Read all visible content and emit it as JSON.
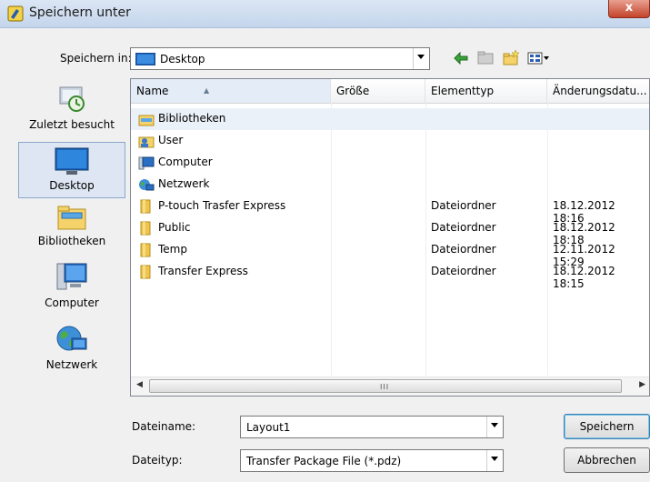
{
  "window": {
    "title": "Speichern unter",
    "close_label": "x"
  },
  "save_in": {
    "label": "Speichern in:",
    "value": "Desktop"
  },
  "places": [
    {
      "label": "Zuletzt besucht",
      "icon": "recent-places-icon"
    },
    {
      "label": "Desktop",
      "icon": "desktop-icon"
    },
    {
      "label": "Bibliotheken",
      "icon": "libraries-icon"
    },
    {
      "label": "Computer",
      "icon": "computer-icon"
    },
    {
      "label": "Netzwerk",
      "icon": "network-icon"
    }
  ],
  "columns": {
    "name": "Name",
    "size": "Größe",
    "type": "Elementtyp",
    "date": "Änderungsdatu..."
  },
  "files": [
    {
      "name": "Bibliotheken",
      "type": "",
      "date": "",
      "icon": "libraries-icon"
    },
    {
      "name": "User",
      "type": "",
      "date": "",
      "icon": "user-folder-icon"
    },
    {
      "name": "Computer",
      "type": "",
      "date": "",
      "icon": "computer-icon"
    },
    {
      "name": "Netzwerk",
      "type": "",
      "date": "",
      "icon": "network-icon"
    },
    {
      "name": "P-touch Trasfer Express",
      "type": "Dateiordner",
      "date": "18.12.2012 18:16",
      "icon": "folder-icon"
    },
    {
      "name": "Public",
      "type": "Dateiordner",
      "date": "18.12.2012 18:18",
      "icon": "folder-icon"
    },
    {
      "name": "Temp",
      "type": "Dateiordner",
      "date": "12.11.2012 15:29",
      "icon": "folder-icon"
    },
    {
      "name": "Transfer Express",
      "type": "Dateiordner",
      "date": "18.12.2012 18:15",
      "icon": "folder-icon"
    }
  ],
  "filename": {
    "label": "Dateiname:",
    "value": "Layout1"
  },
  "filetype": {
    "label": "Dateityp:",
    "value": "Transfer Package File (*.pdz)"
  },
  "buttons": {
    "save": "Speichern",
    "cancel": "Abbrechen"
  },
  "scroll": {
    "grip": "III"
  }
}
